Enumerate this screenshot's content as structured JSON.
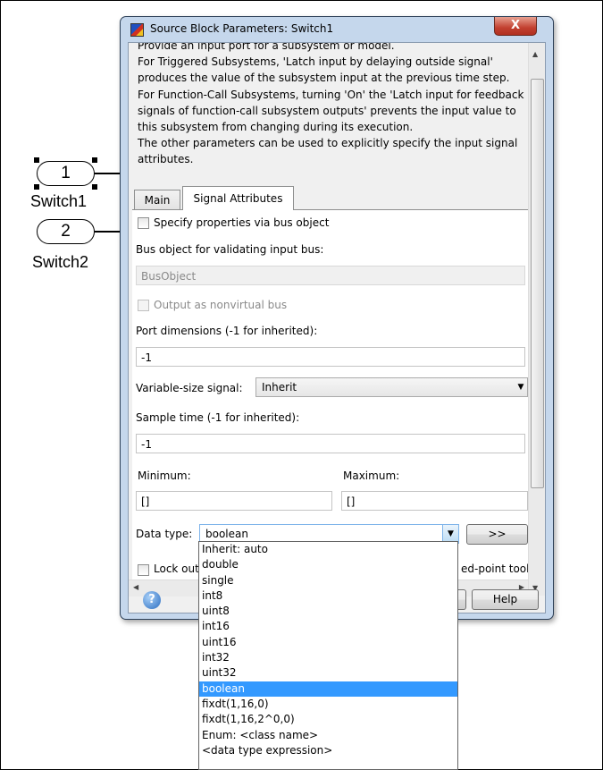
{
  "canvas": {
    "ports": [
      {
        "number": "1",
        "label": "Switch1",
        "selected": true
      },
      {
        "number": "2",
        "label": "Switch2",
        "selected": false
      }
    ]
  },
  "dialog": {
    "title": "Source Block Parameters: Switch1",
    "close_label": "X",
    "description_lines": [
      "Provide an input port for a subsystem or model.",
      "For Triggered Subsystems, 'Latch input by delaying outside signal'",
      "produces the value of the subsystem input at the previous time step.",
      "For Function-Call Subsystems, turning 'On' the 'Latch input for feedback",
      "signals of function-call subsystem outputs' prevents the input value to",
      "this subsystem from changing during its execution.",
      "The other parameters can be used to explicitly specify the input signal",
      "attributes."
    ],
    "tabs": [
      {
        "label": "Main",
        "active": false
      },
      {
        "label": "Signal Attributes",
        "active": true
      }
    ],
    "bus_checkbox_label": "Specify properties via bus object",
    "bus_object_label": "Bus object for validating input bus:",
    "bus_object_value": "BusObject",
    "nonvirtual_label": "Output as nonvirtual bus",
    "port_dim_label": "Port dimensions (-1 for inherited):",
    "port_dim_value": "-1",
    "varsize_label": "Variable-size signal:",
    "varsize_value": "Inherit",
    "sample_time_label": "Sample time (-1 for inherited):",
    "sample_time_value": "-1",
    "min_label": "Minimum:",
    "min_value": "[]",
    "max_label": "Maximum:",
    "max_value": "[]",
    "datatype_label": "Data type:",
    "datatype_value": "boolean",
    "assistant_button": ">>",
    "lock_label_fragment": "Lock out",
    "fixed_point_fragment": "ed-point tool",
    "help_icon": "?",
    "help_button": "Help"
  },
  "datatype_options": [
    "Inherit: auto",
    "double",
    "single",
    "int8",
    "uint8",
    "int16",
    "uint16",
    "int32",
    "uint32",
    "boolean",
    "fixdt(1,16,0)",
    "fixdt(1,16,2^0,0)",
    "Enum: <class name>",
    "<data type expression>"
  ],
  "selected_option": "boolean",
  "colors": {
    "selection": "#3399ff",
    "window_frame": "#c5d7ec"
  }
}
